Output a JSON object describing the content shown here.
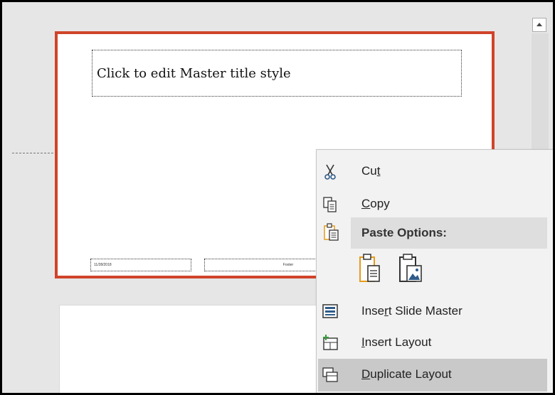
{
  "slide": {
    "title_placeholder": "Click to edit Master title style",
    "footer_date": "11/28/2018",
    "footer_text": "Footer"
  },
  "context_menu": {
    "items": [
      {
        "id": "cut",
        "pre": "Cu",
        "ul": "t",
        "post": "",
        "icon": "scissors-icon"
      },
      {
        "id": "copy",
        "pre": "",
        "ul": "C",
        "post": "opy",
        "icon": "copy-icon"
      },
      {
        "id": "paste_options",
        "label": "Paste Options:",
        "icon": "paste-icon"
      },
      {
        "id": "insert_slide_master",
        "pre": "Inse",
        "ul": "r",
        "post": "t Slide Master",
        "icon": "slide-master-icon"
      },
      {
        "id": "insert_layout",
        "pre": "",
        "ul": "I",
        "post": "nsert Layout",
        "icon": "insert-layout-icon"
      },
      {
        "id": "duplicate_layout",
        "pre": "",
        "ul": "D",
        "post": "uplicate Layout",
        "icon": "duplicate-layout-icon",
        "highlighted": true
      }
    ],
    "paste_buttons": [
      {
        "id": "keep-text-only",
        "icon": "paste-keep-text-icon"
      },
      {
        "id": "picture",
        "icon": "paste-picture-icon"
      }
    ]
  },
  "colors": {
    "selection_border": "#d0442a",
    "menu_bg": "#f2f2f2",
    "menu_highlight": "#c9c9c9",
    "accent_orange": "#e49a1b",
    "icon_blue": "#2e5b8a"
  }
}
